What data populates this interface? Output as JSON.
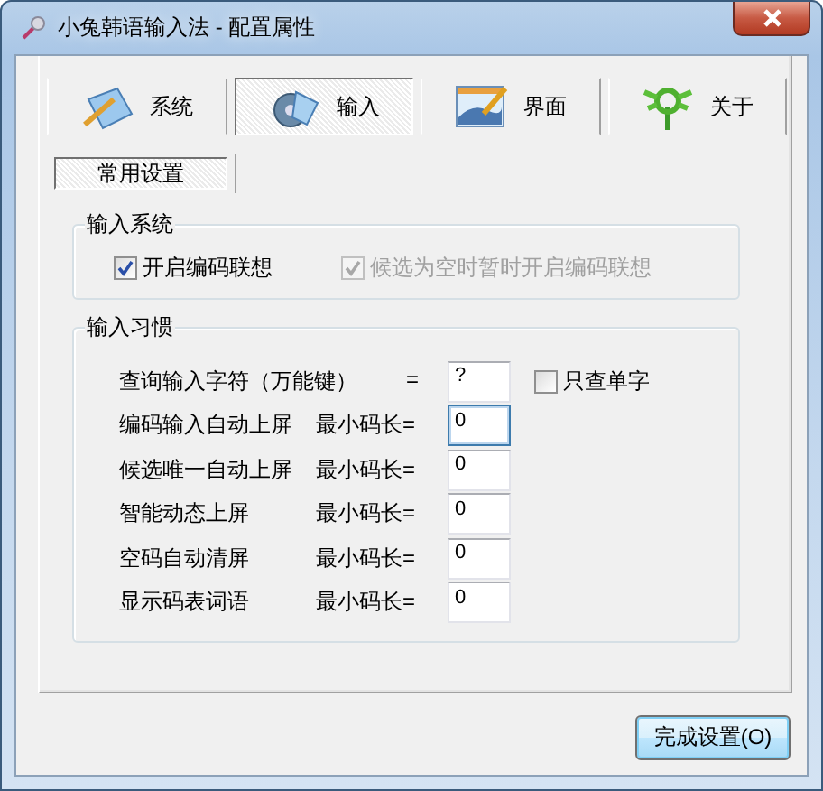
{
  "window": {
    "title": "小兔韩语输入法 - 配置属性"
  },
  "tabs": [
    {
      "label": "系统",
      "selected": false
    },
    {
      "label": "输入",
      "selected": true
    },
    {
      "label": "界面",
      "selected": false
    },
    {
      "label": "关于",
      "selected": false
    }
  ],
  "subtabs": [
    {
      "label": "常用设置",
      "selected": true
    }
  ],
  "input_system": {
    "title": "输入系统",
    "options": [
      {
        "label": "开启编码联想",
        "checked": true,
        "disabled": false
      },
      {
        "label": "候选为空时暂时开启编码联想",
        "checked": true,
        "disabled": true
      }
    ]
  },
  "input_habits": {
    "title": "输入习惯",
    "rows": [
      {
        "label": "查询输入字符（万能键）",
        "operator": "=",
        "value": "?",
        "focused": false,
        "option": {
          "label": "只查单字",
          "checked": false,
          "disabled": false
        }
      },
      {
        "label": "编码输入自动上屏",
        "operator": "最小码长=",
        "value": "0",
        "focused": true
      },
      {
        "label": "候选唯一自动上屏",
        "operator": "最小码长=",
        "value": "0",
        "focused": false
      },
      {
        "label": "智能动态上屏",
        "operator": "最小码长=",
        "value": "0",
        "focused": false
      },
      {
        "label": "空码自动清屏",
        "operator": "最小码长=",
        "value": "0",
        "focused": false
      },
      {
        "label": "显示码表词语",
        "operator": "最小码长=",
        "value": "0",
        "focused": false
      }
    ]
  },
  "buttons": [
    {
      "label": "完成设置(O)",
      "default": true
    }
  ]
}
